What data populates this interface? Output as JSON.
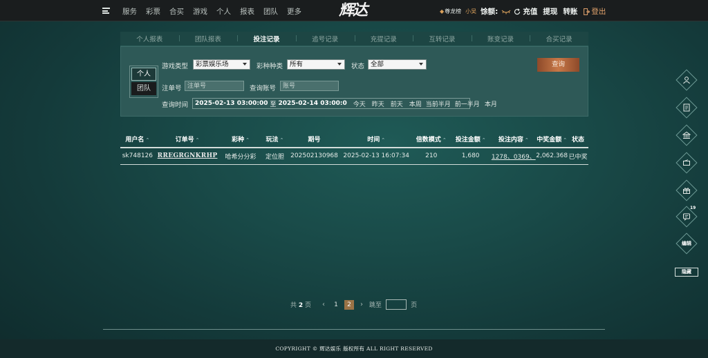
{
  "header": {
    "nav": [
      "服务",
      "彩票",
      "合买",
      "游戏",
      "个人",
      "报表",
      "团队",
      "更多"
    ],
    "logo": "辉达",
    "vip_label": "尊龙榜",
    "username": "小吴",
    "balance_label": "馀额:",
    "recharge": "充值",
    "withdraw": "提现",
    "transfer": "转账",
    "logout": "登出"
  },
  "tabs": [
    "个人报表",
    "团队报表",
    "投注记录",
    "追号记录",
    "充提记录",
    "互转记录",
    "账变记录",
    "合买记录"
  ],
  "active_tab": "投注记录",
  "filters": {
    "scope_personal": "个人",
    "scope_team": "团队",
    "game_type_label": "游戏类型",
    "game_type_value": "彩票娱乐场",
    "lottery_kind_label": "彩种种类",
    "lottery_kind_value": "所有",
    "status_label": "状态",
    "status_value": "全部",
    "order_no_label": "注单号",
    "order_no_placeholder": "注单号",
    "account_label": "查询账号",
    "account_placeholder": "账号",
    "time_label": "查询时间",
    "date_from": "2025-02-13 03:00:00",
    "date_to_sep": "至",
    "date_to": "2025-02-14 03:00:0",
    "quick_dates": [
      "今天",
      "昨天",
      "前天",
      "本周",
      "当前半月",
      "前一半月",
      "本月"
    ],
    "query_button": "查询"
  },
  "table": {
    "columns": [
      "用户名",
      "订单号",
      "彩种",
      "玩法",
      "期号",
      "时间",
      "倍数模式",
      "投注金额",
      "投注内容",
      "中奖金额",
      "状态"
    ],
    "rows": [
      [
        "sk748126",
        "RREGRGNKRHP",
        "哈希分分彩",
        "定位胆",
        "202502130968",
        "2025-02-13 16:07:34",
        "210",
        "1,680",
        "1278、0369、",
        "2,062.368",
        "已中奖"
      ]
    ]
  },
  "pagination": {
    "total_prefix": "共",
    "total_pages": "2",
    "total_suffix": "页",
    "pages": [
      "1",
      "2"
    ],
    "current": "2",
    "jump_label": "跳至",
    "jump_suffix": "页"
  },
  "side": {
    "badge_count": "19",
    "edit_label": "编辑",
    "hide_label": "隐藏"
  },
  "footer": "COPYRIGHT © 辉达娱乐 版权所有 ALL RIGHT RESERVED"
}
